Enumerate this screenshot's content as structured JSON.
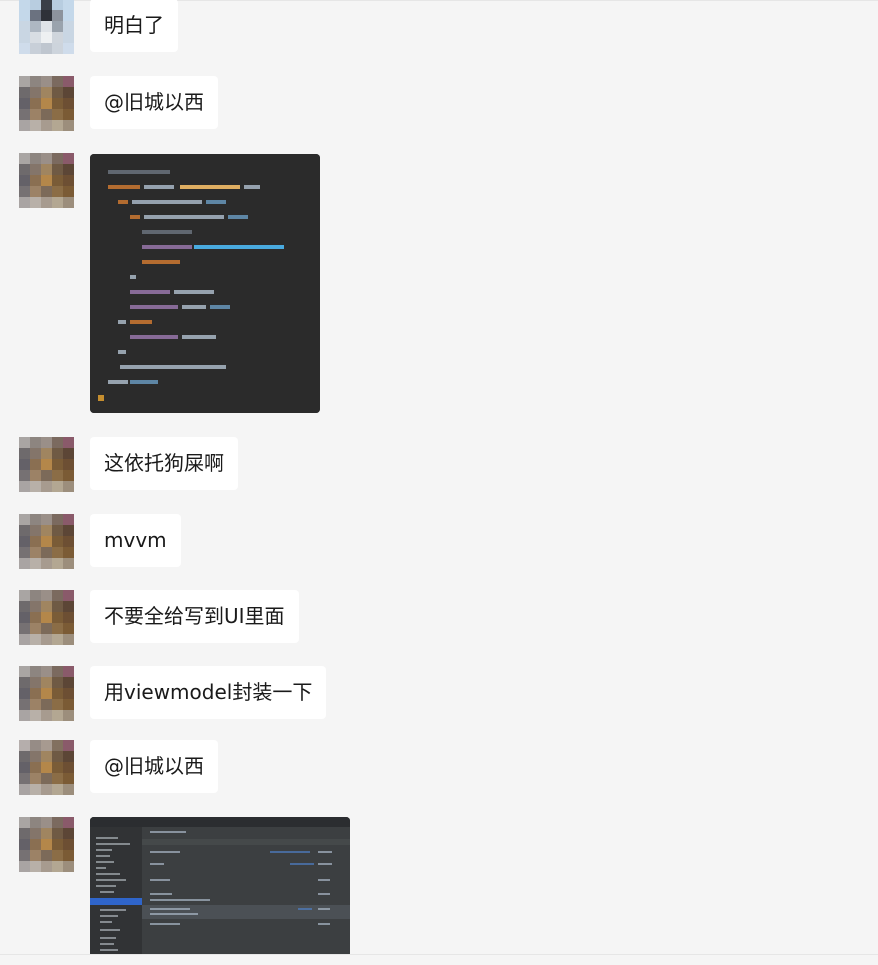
{
  "chat": {
    "messages": [
      {
        "type": "text",
        "text": "明白了"
      },
      {
        "type": "text",
        "text": "@旧城以西"
      },
      {
        "type": "image",
        "description": "code-screenshot"
      },
      {
        "type": "text",
        "text": "这依托狗屎啊"
      },
      {
        "type": "text",
        "text": "mvvm"
      },
      {
        "type": "text",
        "text": "不要全给写到UI里面"
      },
      {
        "type": "text",
        "text": "用viewmodel封装一下"
      },
      {
        "type": "text",
        "text": "@旧城以西"
      },
      {
        "type": "image",
        "description": "ide-screenshot"
      }
    ]
  },
  "colors": {
    "page_bg": "#f5f5f5",
    "bubble_bg": "#ffffff",
    "text": "#1a1a1a",
    "code_bg": "#2b2b2b",
    "ide_bg": "#3c3f41"
  }
}
